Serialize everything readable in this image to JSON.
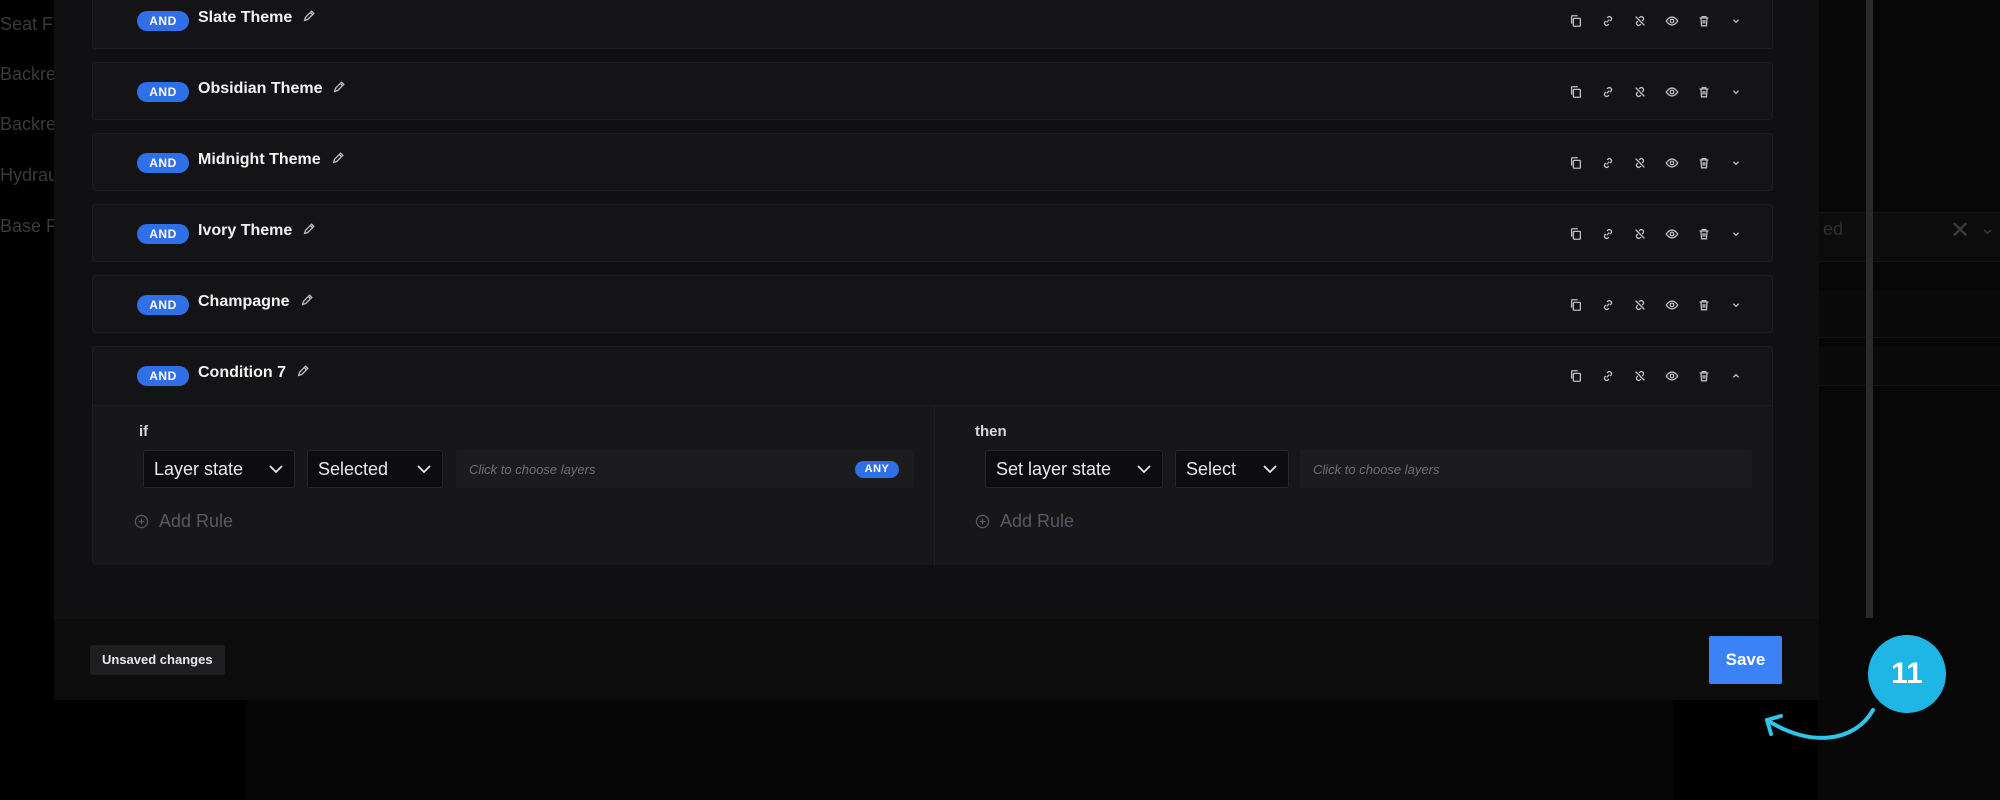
{
  "background": {
    "left_items": [
      "Seat Fa",
      "Backres",
      "Backres",
      "Hydrau",
      "Base Fr"
    ],
    "right_text": "ed"
  },
  "conditions": [
    {
      "badge": "AND",
      "name": "Slate Theme",
      "expanded": false
    },
    {
      "badge": "AND",
      "name": "Obsidian Theme",
      "expanded": false
    },
    {
      "badge": "AND",
      "name": "Midnight Theme",
      "expanded": false
    },
    {
      "badge": "AND",
      "name": "Ivory Theme",
      "expanded": false
    },
    {
      "badge": "AND",
      "name": "Champagne",
      "expanded": false
    },
    {
      "badge": "AND",
      "name": "Condition 7",
      "expanded": true
    }
  ],
  "icons": [
    "copy-icon",
    "link-icon",
    "unlink-icon",
    "eye-icon",
    "trash-icon",
    "chevron-icon"
  ],
  "expanded": {
    "if": {
      "label": "if",
      "select1": "Layer state",
      "select2": "Selected",
      "layers_placeholder": "Click to choose layers",
      "any_badge": "ANY",
      "add_rule": "Add Rule"
    },
    "then": {
      "label": "then",
      "select1": "Set layer state",
      "select2": "Select",
      "layers_placeholder": "Click to choose layers",
      "add_rule": "Add Rule"
    }
  },
  "footer": {
    "unsaved_label": "Unsaved changes",
    "save_label": "Save"
  },
  "callout": {
    "step_number": "11"
  },
  "colors": {
    "accent": "#2f6fe8",
    "save": "#3b82f6",
    "callout": "#1fb6e6"
  }
}
